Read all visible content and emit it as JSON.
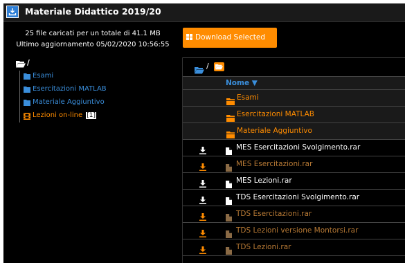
{
  "header": {
    "title": "Materiale Didattico 2019/20",
    "info_line1": "25 file caricati per un totale di 41.1 MB",
    "info_line2": "Ultimo aggiornamento 05/02/2020 10:56:55"
  },
  "toolbar": {
    "download_label": "Download Selected"
  },
  "tree": {
    "root_label": "/",
    "items": [
      {
        "label": "Esami",
        "state": "link"
      },
      {
        "label": "Esercitazioni MATLAB",
        "state": "link"
      },
      {
        "label": "Materiale Aggiuntivo",
        "state": "link"
      },
      {
        "label": "Lezioni on-line",
        "state": "current",
        "badge": "[1]"
      }
    ]
  },
  "breadcrumb": {
    "root": "/"
  },
  "table": {
    "column_header": "Nome ▼",
    "rows": [
      {
        "type": "folder",
        "name": "Esami"
      },
      {
        "type": "folder",
        "name": "Esercitazioni MATLAB"
      },
      {
        "type": "folder",
        "name": "Materiale Aggiuntivo"
      },
      {
        "type": "file",
        "name": "MES Esercitazioni Svolgimento.rar",
        "style": "white"
      },
      {
        "type": "file",
        "name": "MES Esercitazioni.rar",
        "style": "dim"
      },
      {
        "type": "file",
        "name": "MES Lezioni.rar",
        "style": "white"
      },
      {
        "type": "file",
        "name": "TDS Esercitazioni Svolgimento.rar",
        "style": "white"
      },
      {
        "type": "file",
        "name": "TDS Esercitazioni.rar",
        "style": "dim"
      },
      {
        "type": "file",
        "name": "TDS Lezioni versione Montorsi.rar",
        "style": "dim"
      },
      {
        "type": "file",
        "name": "TDS Lezioni.rar",
        "style": "dim"
      }
    ]
  },
  "colors": {
    "accent_orange": "#ff8c00",
    "link_blue": "#3a8edb",
    "dim_orange": "#b87a35",
    "background": "#000000"
  },
  "icons": {
    "title": "download-box-icon",
    "download_button": "grid-icon",
    "folder_open": "folder-open-icon",
    "folder": "folder-icon",
    "film": "film-icon",
    "file": "file-icon",
    "download": "download-arrow-icon"
  }
}
